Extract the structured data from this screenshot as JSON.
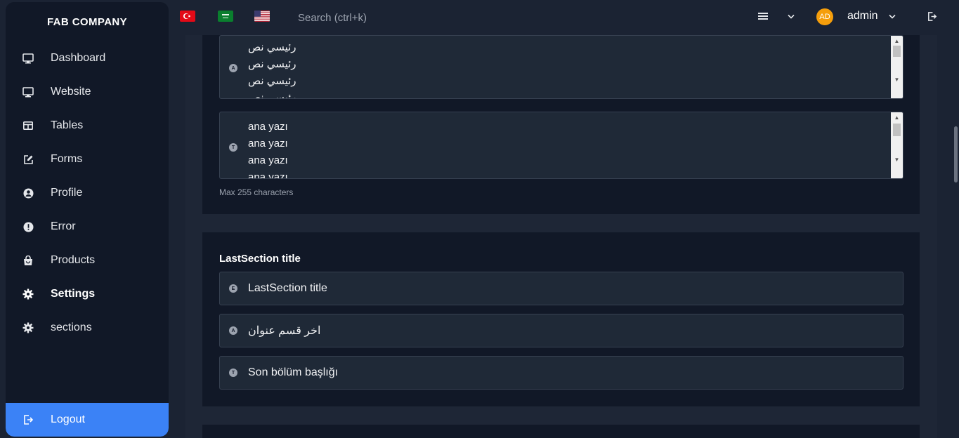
{
  "brand": "FAB COMPANY",
  "sidebar": {
    "items": [
      {
        "label": "Dashboard",
        "icon": "monitor-icon"
      },
      {
        "label": "Website",
        "icon": "monitor-icon"
      },
      {
        "label": "Tables",
        "icon": "table-icon"
      },
      {
        "label": "Forms",
        "icon": "edit-icon"
      },
      {
        "label": "Profile",
        "icon": "user-circle-icon"
      },
      {
        "label": "Error",
        "icon": "alert-circle-icon"
      },
      {
        "label": "Products",
        "icon": "shopping-bag-icon"
      },
      {
        "label": "Settings",
        "icon": "gear-icon"
      },
      {
        "label": "sections",
        "icon": "gear-icon"
      }
    ],
    "active": "Settings",
    "logout_label": "Logout"
  },
  "topbar": {
    "flags": [
      "turkey-flag-icon",
      "saudi-flag-icon",
      "usa-flag-icon"
    ],
    "search_placeholder": "Search (ctrl+k)",
    "avatar_initials": "AD",
    "username": "admin"
  },
  "main": {
    "arabic_textarea": {
      "badge": "A",
      "lines": [
        "رئيسي نص",
        "رئيسي نص",
        "رئيسي نص",
        "رئيسي نص"
      ]
    },
    "turkish_textarea": {
      "badge": "T",
      "lines": [
        "ana yazı",
        "ana yazı",
        "ana yazı",
        "ana yazı"
      ]
    },
    "hint": "Max 255 characters",
    "last_section": {
      "title": "LastSection title",
      "fields": [
        {
          "badge": "E",
          "value": "LastSection title"
        },
        {
          "badge": "A",
          "value": "اخر قسم عنوان"
        },
        {
          "badge": "T",
          "value": "Son bölüm başlığı"
        }
      ]
    }
  },
  "colors": {
    "accent": "#3b82f6",
    "sidebar_bg": "#111827",
    "page_bg": "#1b2333",
    "avatar": "#f59e0b"
  }
}
